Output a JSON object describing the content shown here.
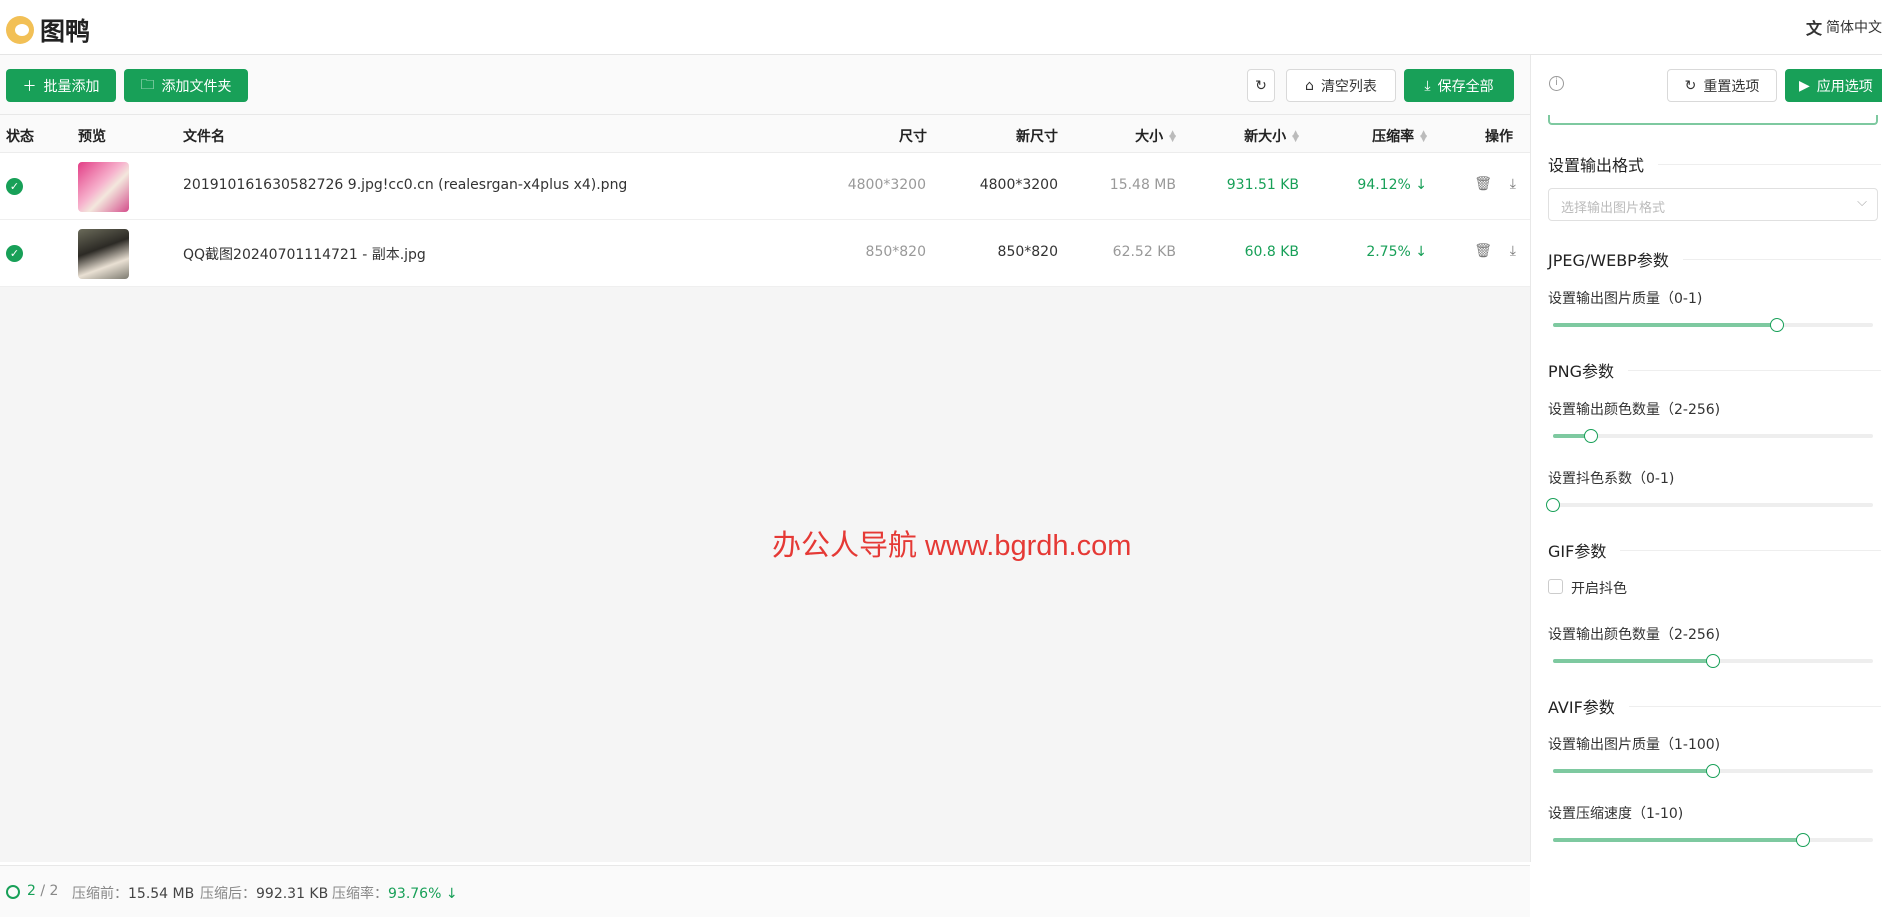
{
  "app": {
    "name": "图鸭",
    "language": "简体中文"
  },
  "toolbar": {
    "batch_add": "批量添加",
    "add_folder": "添加文件夹",
    "clear_list": "清空列表",
    "save_all": "保存全部"
  },
  "table": {
    "headers": {
      "status": "状态",
      "preview": "预览",
      "filename": "文件名",
      "dimensions": "尺寸",
      "new_dimensions": "新尺寸",
      "size": "大小",
      "new_size": "新大小",
      "compression_rate": "压缩率",
      "actions": "操作"
    },
    "rows": [
      {
        "filename": "201910161630582726 9.jpg!cc0.cn (realesrgan-x4plus x4).png",
        "dimensions": "4800*3200",
        "new_dimensions": "4800*3200",
        "size": "15.48 MB",
        "new_size": "931.51 KB",
        "rate": "94.12%"
      },
      {
        "filename": "QQ截图20240701114721 - 副本.jpg",
        "dimensions": "850*820",
        "new_dimensions": "850*820",
        "size": "62.52 KB",
        "new_size": "60.8 KB",
        "rate": "2.75%"
      }
    ]
  },
  "watermark": "办公人导航 www.bgrdh.com",
  "footer": {
    "done": "2",
    "total": "/ 2",
    "before_label": "压缩前：",
    "before": "15.54 MB",
    "after_label": "压缩后：",
    "after": "992.31 KB",
    "rate_label": "压缩率：",
    "rate": "93.76%"
  },
  "panel": {
    "reset": "重置选项",
    "apply": "应用选项",
    "output_format_title": "设置输出格式",
    "output_format_placeholder": "选择输出图片格式",
    "jpeg_title": "JPEG/WEBP参数",
    "jpeg_quality_label": "设置输出图片质量（0-1)",
    "png_title": "PNG参数",
    "png_colors_label": "设置输出颜色数量（2-256)",
    "png_dither_label": "设置抖色系数（0-1)",
    "gif_title": "GIF参数",
    "gif_dither_label": "开启抖色",
    "gif_colors_label": "设置输出颜色数量（2-256)",
    "avif_title": "AVIF参数",
    "avif_quality_label": "设置输出图片质量（1-100)",
    "avif_speed_label": "设置压缩速度（1-10)"
  },
  "sliders": {
    "jpeg_quality": 0.7,
    "png_colors": 0.12,
    "png_dither": 0.0,
    "gif_colors": 0.5,
    "avif_quality": 0.5,
    "avif_speed": 0.78
  },
  "colors": {
    "accent": "#18a058",
    "watermark": "#e53935"
  }
}
